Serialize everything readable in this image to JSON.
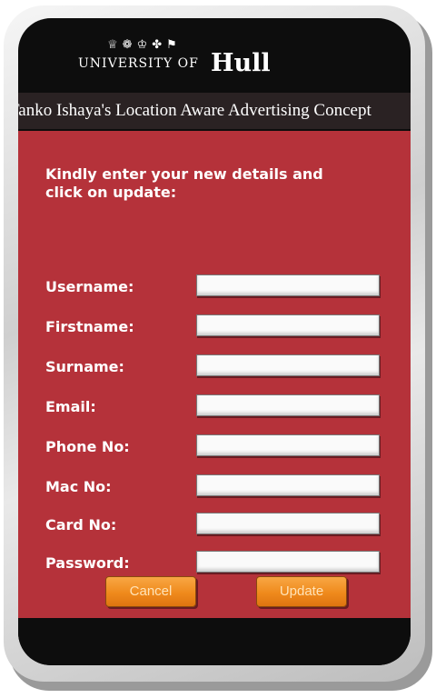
{
  "brand": {
    "university_label": "UNIVERSITY OF",
    "hull_label": "Hull",
    "crest_icons": [
      "crest-icon-1",
      "crest-icon-2",
      "crest-icon-3",
      "crest-icon-4",
      "crest-icon-5"
    ]
  },
  "app_title": "Tanko Ishaya's Location Aware Advertising Concept",
  "instructions": "Kindly enter your new details and click on update:",
  "form": {
    "fields": [
      {
        "label": "Username:",
        "value": ""
      },
      {
        "label": "Firstname:",
        "value": ""
      },
      {
        "label": "Surname:",
        "value": ""
      },
      {
        "label": "Email:",
        "value": ""
      },
      {
        "label": "Phone No:",
        "value": ""
      },
      {
        "label": "Mac No:",
        "value": ""
      },
      {
        "label": "Card No:",
        "value": ""
      },
      {
        "label": "Password:",
        "value": ""
      }
    ]
  },
  "buttons": {
    "cancel_label": "Cancel",
    "update_label": "Update"
  },
  "colors": {
    "accent": "#b5323a",
    "button": "#ef8a1c",
    "frame": "#0d0d0d"
  }
}
